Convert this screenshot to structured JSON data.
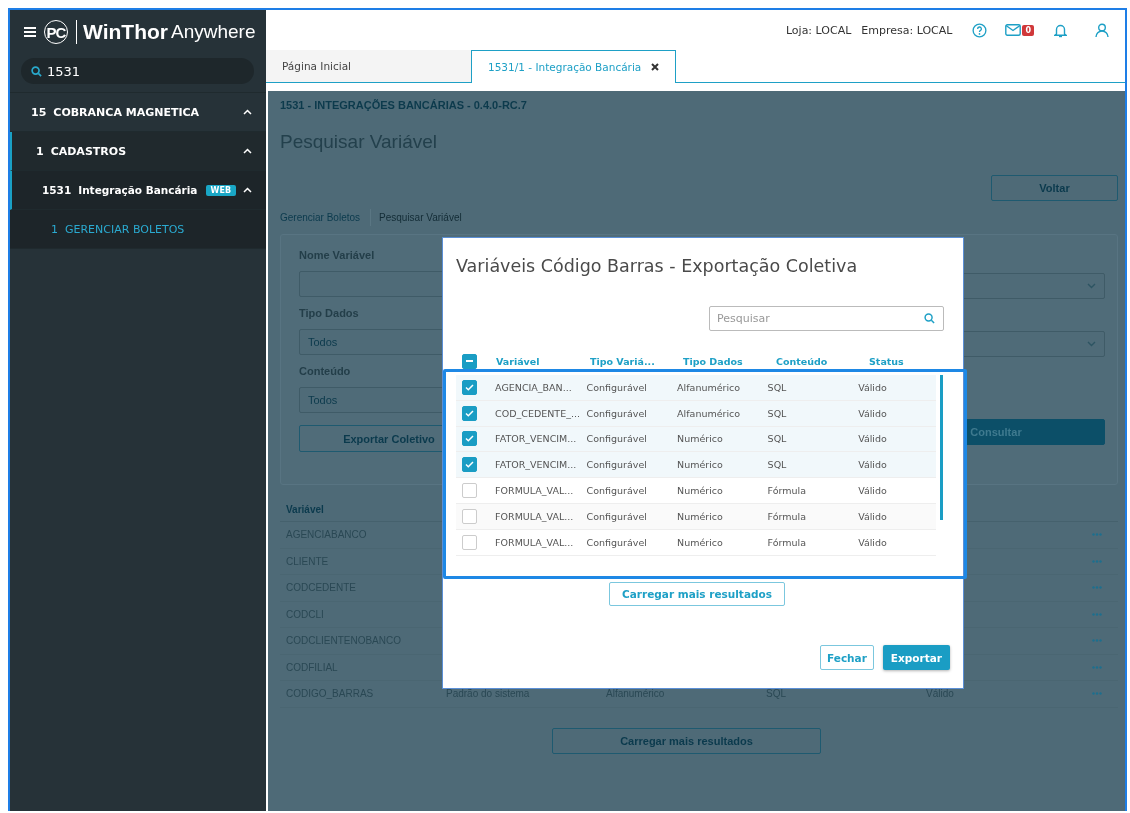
{
  "brand": {
    "mark": "PC",
    "name": "WinThor",
    "suffix": "Anywhere"
  },
  "sidebar": {
    "search": {
      "value": "1531"
    },
    "menu": [
      {
        "code": "15",
        "label": "COBRANCA MAGNETICA",
        "expanded": true,
        "selected": false,
        "children": [
          {
            "code": "1",
            "label": "CADASTROS",
            "expanded": true,
            "selected": false,
            "children": [
              {
                "code": "1531",
                "label": "Integração Bancária",
                "badge": "WEB",
                "expanded": true,
                "selected": false,
                "children": [
                  {
                    "code": "1",
                    "label": "GERENCIAR BOLETOS",
                    "selected": true
                  }
                ]
              }
            ]
          }
        ]
      }
    ]
  },
  "topbar": {
    "store": "Loja: LOCAL",
    "company": "Empresa: LOCAL",
    "mail_count": "0"
  },
  "tabs": [
    {
      "label": "Página Inicial",
      "selected": false,
      "closable": false
    },
    {
      "label": "1531/1 - Integração Bancária",
      "selected": true,
      "closable": true
    }
  ],
  "page": {
    "module": "1531 - INTEGRAÇÕES BANCÁRIAS - 0.4.0-RC.7",
    "title": "Pesquisar Variável",
    "back_button": "Voltar",
    "breadcrumb": [
      "Gerenciar Boletos",
      "Pesquisar Variável"
    ],
    "filters": [
      {
        "label": "Nome Variável"
      },
      {
        "label": "Tipo Dados",
        "value": "Todos"
      },
      {
        "label": "Conteúdo",
        "value": "Todos"
      }
    ],
    "export_button": "Exportar Coletivo",
    "search_button": "Consultar",
    "table": {
      "columns": [
        "Variável"
      ],
      "rows": [
        [
          "AGENCIABANCO"
        ],
        [
          "CLIENTE"
        ],
        [
          "CODCEDENTE"
        ],
        [
          "CODCLI"
        ],
        [
          "CODCLIENTENOBANCO"
        ],
        [
          "CODFILIAL"
        ],
        [
          "CODIGO_BARRAS",
          "Padrão do sistema",
          "Alfanumérico",
          "SQL",
          "Válido"
        ]
      ]
    },
    "load_more": "Carregar mais resultados"
  },
  "dialog": {
    "title": "Variáveis Código Barras - Exportação Coletiva",
    "search": {
      "placeholder": "Pesquisar"
    },
    "select_all_indeterminate": true,
    "columns": [
      "Variável",
      "Tipo Variá...",
      "Tipo Dados",
      "Conteúdo",
      "Status"
    ],
    "rows": [
      {
        "checked": true,
        "cells": [
          "AGENCIA_BAN...",
          "Configurável",
          "Alfanumérico",
          "SQL",
          "Válido"
        ]
      },
      {
        "checked": true,
        "cells": [
          "COD_CEDENTE_...",
          "Configurável",
          "Alfanumérico",
          "SQL",
          "Válido"
        ]
      },
      {
        "checked": true,
        "cells": [
          "FATOR_VENCIM...",
          "Configurável",
          "Numérico",
          "SQL",
          "Válido"
        ]
      },
      {
        "checked": true,
        "cells": [
          "FATOR_VENCIM...",
          "Configurável",
          "Numérico",
          "SQL",
          "Válido"
        ]
      },
      {
        "checked": false,
        "cells": [
          "FORMULA_VAL...",
          "Configurável",
          "Numérico",
          "Fórmula",
          "Válido"
        ]
      },
      {
        "checked": false,
        "cells": [
          "FORMULA_VAL...",
          "Configurável",
          "Numérico",
          "Fórmula",
          "Válido"
        ]
      },
      {
        "checked": false,
        "cells": [
          "FORMULA_VAL...",
          "Configurável",
          "Numérico",
          "Fórmula",
          "Válido"
        ]
      }
    ],
    "load_more": "Carregar mais resultados",
    "close_button": "Fechar",
    "export_button": "Exportar"
  }
}
